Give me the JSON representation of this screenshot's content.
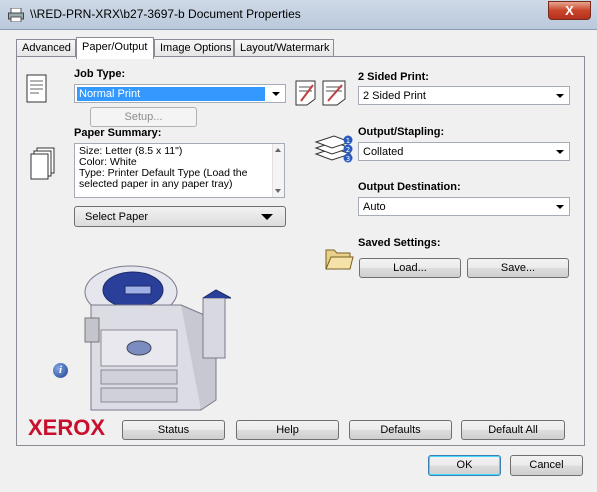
{
  "window": {
    "title": "\\\\RED-PRN-XRX\\b27-3697-b Document Properties",
    "close_label": "X"
  },
  "tabs": [
    {
      "label": "Advanced"
    },
    {
      "label": "Paper/Output",
      "active": true
    },
    {
      "label": "Image Options"
    },
    {
      "label": "Layout/Watermark"
    }
  ],
  "job_type": {
    "label": "Job Type:",
    "value": "Normal Print",
    "setup_label": "Setup..."
  },
  "paper_summary": {
    "label": "Paper Summary:",
    "lines": [
      "Size: Letter (8.5 x 11\")",
      "Color: White",
      "Type: Printer Default Type (Load the",
      "selected paper in any paper tray)"
    ],
    "select_label": "Select Paper"
  },
  "two_sided": {
    "label": "2 Sided Print:",
    "value": "2 Sided Print"
  },
  "output_stapling": {
    "label": "Output/Stapling:",
    "value": "Collated"
  },
  "output_destination": {
    "label": "Output Destination:",
    "value": "Auto"
  },
  "saved_settings": {
    "label": "Saved Settings:",
    "load_label": "Load...",
    "save_label": "Save..."
  },
  "info_icon_glyph": "i",
  "brand": {
    "logo_text": "XEROX",
    "color": "#c8102e"
  },
  "bottom_buttons": {
    "status": "Status",
    "help": "Help",
    "defaults": "Defaults",
    "default_all": "Default All"
  },
  "dialog_buttons": {
    "ok": "OK",
    "cancel": "Cancel"
  }
}
